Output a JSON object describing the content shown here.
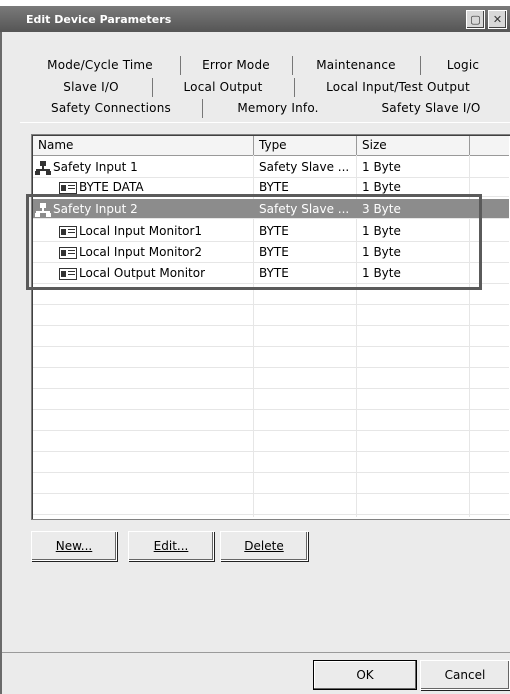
{
  "window": {
    "title": "Edit Device Parameters"
  },
  "tabs": {
    "row1": [
      "Mode/Cycle Time",
      "Error Mode",
      "Maintenance",
      "Logic"
    ],
    "row2": [
      "Slave I/O",
      "Local Output",
      "Local Input/Test Output"
    ],
    "row3": [
      "Safety Connections",
      "Memory Info.",
      "Safety Slave I/O"
    ]
  },
  "table": {
    "columns": [
      "Name",
      "Type",
      "Size"
    ],
    "rows": [
      {
        "name": "Safety Input 1",
        "type": "Safety Slave ...",
        "size": "1 Byte",
        "icon": "safety-input-icon"
      },
      {
        "name": "BYTE DATA",
        "type": "BYTE",
        "size": "1 Byte",
        "icon": "byte-data-icon"
      },
      {
        "name": "Safety Input 2",
        "type": "Safety Slave ...",
        "size": "3 Byte",
        "icon": "safety-input-icon"
      },
      {
        "name": "Local Input Monitor1",
        "type": "BYTE",
        "size": "1 Byte",
        "icon": "monitor-data-icon"
      },
      {
        "name": "Local Input Monitor2",
        "type": "BYTE",
        "size": "1 Byte",
        "icon": "monitor-data-icon"
      },
      {
        "name": "Local Output Monitor",
        "type": "BYTE",
        "size": "1 Byte",
        "icon": "monitor-data-icon"
      }
    ]
  },
  "buttons": {
    "new": "New...",
    "edit": "Edit...",
    "delete": "Delete",
    "ok": "OK",
    "cancel": "Cancel"
  }
}
